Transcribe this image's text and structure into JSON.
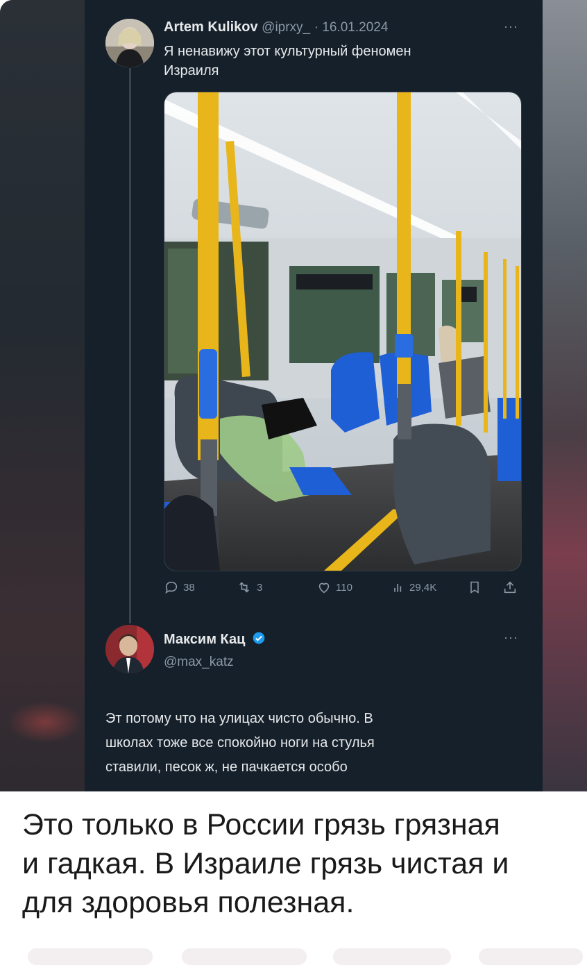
{
  "tweet1": {
    "author_name": "Artem Kulikov",
    "handle": "@iprxy_",
    "date": "· 16.01.2024",
    "more_label": "···",
    "text_line1": "Я ненавижу этот культурный феномен",
    "text_line2": "Израиля",
    "stats": {
      "replies": "38",
      "reposts": "3",
      "likes": "110",
      "views": "29,4K"
    }
  },
  "tweet2": {
    "author_name": "Максим Кац",
    "handle": "@max_katz",
    "more_label": "···",
    "text_line1": "Эт потому что на улицах чисто обычно. В",
    "text_line2": "школах тоже все спокойно ноги на стулья",
    "text_line3": "ставили, песок ж, не пачкается особо"
  },
  "caption": {
    "line1": "Это только в России грязь грязная",
    "line2": "и гадкая. В Израиле грязь чистая и",
    "line3": "для здоровья полезная."
  },
  "colors": {
    "tweet_bg": "#15202b",
    "text_primary": "#e7e9ea",
    "text_secondary": "#8b98a5",
    "verified_blue": "#1d9bf0",
    "bus_pole_yellow": "#e8b51a",
    "seat_blue": "#1f5fd6"
  },
  "icons": [
    "reply-icon",
    "repost-icon",
    "like-icon",
    "views-icon",
    "bookmark-icon",
    "share-icon",
    "verified-icon",
    "more-icon"
  ]
}
